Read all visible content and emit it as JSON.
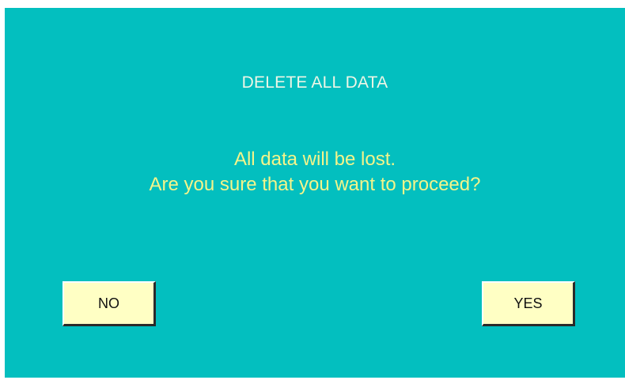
{
  "dialog": {
    "title": "DELETE ALL DATA",
    "message_line1": "All data will be lost.",
    "message_line2": "Are you sure that you want to proceed?",
    "no_label": "NO",
    "yes_label": "YES"
  },
  "colors": {
    "background": "#03bfbf",
    "title_text": "#eef6e6",
    "message_text": "#f4f48a",
    "button_face": "#ffffc4"
  }
}
